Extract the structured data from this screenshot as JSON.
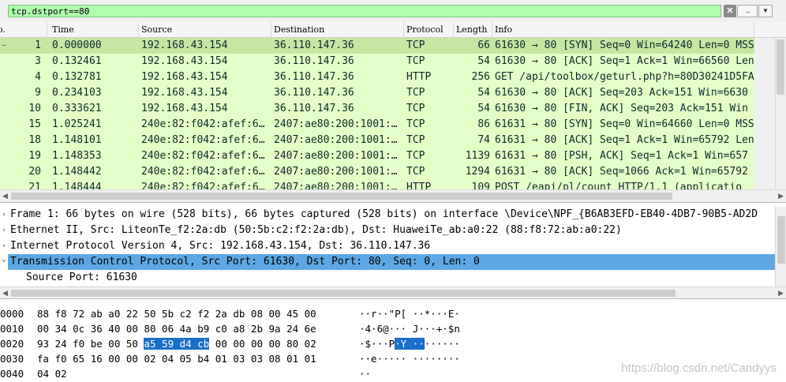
{
  "filter": {
    "text": "tcp.dstport==80",
    "clear_label": "✕",
    "apply_label": "→",
    "dropdown_label": "▼"
  },
  "packet_list": {
    "columns": [
      "o.",
      "Time",
      "Source",
      "Destination",
      "Protocol",
      "Length",
      "Info"
    ],
    "rows": [
      {
        "no": "1",
        "time": "0.000000",
        "source": "192.168.43.154",
        "destination": "36.110.147.36",
        "protocol": "TCP",
        "length": "66",
        "info": "61630 → 80 [SYN] Seq=0 Win=64240 Len=0 MSS",
        "selected": true
      },
      {
        "no": "3",
        "time": "0.132461",
        "source": "192.168.43.154",
        "destination": "36.110.147.36",
        "protocol": "TCP",
        "length": "54",
        "info": "61630 → 80 [ACK] Seq=1 Ack=1 Win=66560 Len"
      },
      {
        "no": "4",
        "time": "0.132781",
        "source": "192.168.43.154",
        "destination": "36.110.147.36",
        "protocol": "HTTP",
        "length": "256",
        "info": "GET /api/toolbox/geturl.php?h=80D30241D5FA"
      },
      {
        "no": "9",
        "time": "0.234103",
        "source": "192.168.43.154",
        "destination": "36.110.147.36",
        "protocol": "TCP",
        "length": "54",
        "info": "61630 → 80 [ACK] Seq=203 Ack=151 Win=6630"
      },
      {
        "no": "10",
        "time": "0.333621",
        "source": "192.168.43.154",
        "destination": "36.110.147.36",
        "protocol": "TCP",
        "length": "54",
        "info": "61630 → 80 [FIN, ACK] Seq=203 Ack=151 Win"
      },
      {
        "no": "15",
        "time": "1.025241",
        "source": "240e:82:f042:afef:6…",
        "destination": "2407:ae80:200:1001:…",
        "protocol": "TCP",
        "length": "86",
        "info": "61631 → 80 [SYN] Seq=0 Win=64660 Len=0 MSS"
      },
      {
        "no": "18",
        "time": "1.148101",
        "source": "240e:82:f042:afef:6…",
        "destination": "2407:ae80:200:1001:…",
        "protocol": "TCP",
        "length": "74",
        "info": "61631 → 80 [ACK] Seq=1 Ack=1 Win=65792 Len"
      },
      {
        "no": "19",
        "time": "1.148353",
        "source": "240e:82:f042:afef:6…",
        "destination": "2407:ae80:200:1001:…",
        "protocol": "TCP",
        "length": "1139",
        "info": "61631 → 80 [PSH, ACK] Seq=1 Ack=1 Win=657"
      },
      {
        "no": "20",
        "time": "1.148442",
        "source": "240e:82:f042:afef:6…",
        "destination": "2407:ae80:200:1001:…",
        "protocol": "TCP",
        "length": "1294",
        "info": "61631 → 80 [ACK] Seq=1066 Ack=1 Win=65792"
      },
      {
        "no": "21",
        "time": "1.148444",
        "source": "240e:82:f042:afef:6…",
        "destination": "2407:ae80:200:1001:…",
        "protocol": "HTTP",
        "length": "109",
        "info": "POST /eapi/pl/count HTTP/1.1  (applicatio"
      }
    ]
  },
  "detail_pane": {
    "lines": [
      {
        "text": "Frame 1: 66 bytes on wire (528 bits), 66 bytes captured (528 bits) on interface \\Device\\NPF_{B6AB3EFD-EB40-4DB7-90B5-AD2D",
        "arrow": "›"
      },
      {
        "text": "Ethernet II, Src: LiteonTe_f2:2a:db (50:5b:c2:f2:2a:db), Dst: HuaweiTe_ab:a0:22 (88:f8:72:ab:a0:22)",
        "arrow": "›"
      },
      {
        "text": "Internet Protocol Version 4, Src: 192.168.43.154, Dst: 36.110.147.36",
        "arrow": "›"
      },
      {
        "text": "Transmission Control Protocol, Src Port: 61630, Dst Port: 80, Seq: 0, Len: 0",
        "arrow": "⌄",
        "selected": true
      },
      {
        "text": "Source Port: 61630",
        "arrow": "",
        "child": true
      }
    ]
  },
  "bytes_pane": {
    "rows": [
      {
        "offset": "0000",
        "hex_pre": "88 f8 72 ab a0 22 50 5b  c2 f2 2a db 08 00 45 00",
        "hex_hl": "",
        "hex_post": "",
        "ascii_pre": "··r··\"P[ ··*···E·",
        "ascii_hl": "",
        "ascii_post": ""
      },
      {
        "offset": "0010",
        "hex_pre": "00 34 0c 36 40 00 80 06  4a b9 c0 a8 2b 9a 24 6e",
        "hex_hl": "",
        "hex_post": "",
        "ascii_pre": "·4·6@··· J···+·$n",
        "ascii_hl": "",
        "ascii_post": ""
      },
      {
        "offset": "0020",
        "hex_pre": "93 24 f0 be 00 50 ",
        "hex_hl": "a5 59  d4 cb",
        "hex_post": " 00 00 00 00 80 02",
        "ascii_pre": "·$···P",
        "ascii_hl": "·Y ··",
        "ascii_post": "······"
      },
      {
        "offset": "0030",
        "hex_pre": "fa f0 65 16 00 00 02 04  05 b4 01 03 03 08 01 01",
        "hex_hl": "",
        "hex_post": "",
        "ascii_pre": "··e····· ········",
        "ascii_hl": "",
        "ascii_post": ""
      },
      {
        "offset": "0040",
        "hex_pre": "04 02",
        "hex_hl": "",
        "hex_post": "",
        "ascii_pre": "··",
        "ascii_hl": "",
        "ascii_post": ""
      }
    ]
  },
  "watermark": "https://blog.csdn.net/Candyys",
  "colors": {
    "filter_valid": "#afffaf",
    "row_tcp": "#e4ffc7",
    "row_selected": "#c5e7a3",
    "detail_selected": "#5da8e4",
    "bytes_highlight": "#1a6fc9",
    "text_dark": "#12272e"
  }
}
